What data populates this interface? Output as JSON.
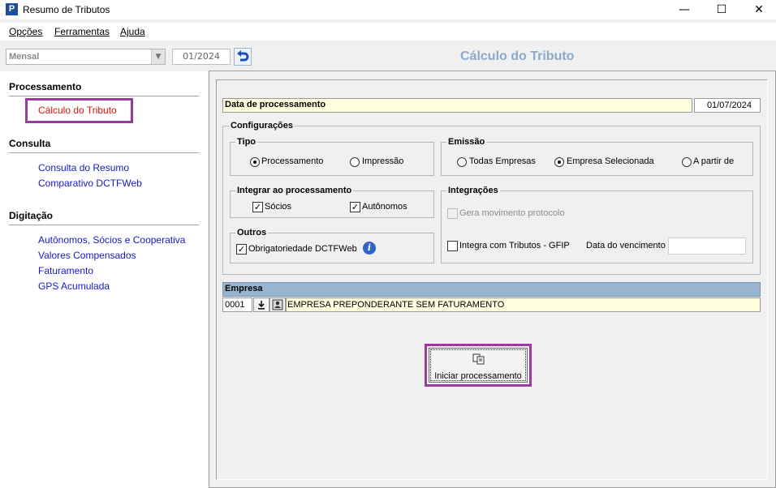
{
  "window": {
    "title": "Resumo de Tributos",
    "icon": "P",
    "controls": {
      "minimize": "—",
      "maximize": "☐",
      "close": "✕"
    }
  },
  "menu": [
    {
      "label": "Opções",
      "mnemonic": "O"
    },
    {
      "label": "Ferramentas",
      "mnemonic": "F"
    },
    {
      "label": "Ajuda",
      "mnemonic": "A"
    }
  ],
  "toolbar": {
    "period_value": "Mensal",
    "month_value": "01/2024",
    "heading": "Cálculo do Tributo"
  },
  "sidebar": {
    "sections": [
      {
        "title": "Processamento",
        "items": [
          "Cálculo do Tributo"
        ],
        "active": "Cálculo do Tributo"
      },
      {
        "title": "Consulta",
        "items": [
          "Consulta do Resumo",
          "Comparativo DCTFWeb"
        ]
      },
      {
        "title": "Digitação",
        "items": [
          "Autônomos, Sócios e Cooperativa",
          "Valores Compensados",
          "Faturamento",
          "GPS Acumulada"
        ]
      }
    ]
  },
  "form": {
    "date_label": "Data de processamento",
    "date_value": "01/07/2024",
    "config_title": "Configurações",
    "tipo": {
      "title": "Tipo",
      "options": [
        "Processamento",
        "Impressão"
      ],
      "selected": "Processamento"
    },
    "emissao": {
      "title": "Emissão",
      "options": [
        "Todas Empresas",
        "Empresa Selecionada",
        "A partir de"
      ],
      "selected": "Empresa Selecionada"
    },
    "integrar": {
      "title": "Integrar ao processamento",
      "socios": {
        "label": "Sócios",
        "checked": true
      },
      "autonomos": {
        "label": "Autônomos",
        "checked": true
      }
    },
    "integracoes": {
      "title": "Integrações",
      "gera_movimento": {
        "label": "Gera movimento protocolo",
        "checked": false,
        "disabled": true
      },
      "integra_gfip": {
        "label": "Integra com Tributos - GFIP",
        "checked": false
      },
      "vencimento_label": "Data do vencimento",
      "vencimento_value": ""
    },
    "outros": {
      "title": "Outros",
      "obrigatoriedade": {
        "label": "Obrigatoriedade DCTFWeb",
        "checked": true
      }
    },
    "empresa": {
      "title": "Empresa",
      "code": "0001",
      "name": "EMPRESA PREPONDERANTE SEM FATURAMENTO"
    },
    "start_button": "Iniciar processamento"
  },
  "colors": {
    "highlight": "#9a3c9e",
    "active_link": "#e01010",
    "link": "#1818c8",
    "heading": "#8aa9cc",
    "empresa_header": "#99b4d1",
    "field_yellow": "#ffffe0"
  }
}
